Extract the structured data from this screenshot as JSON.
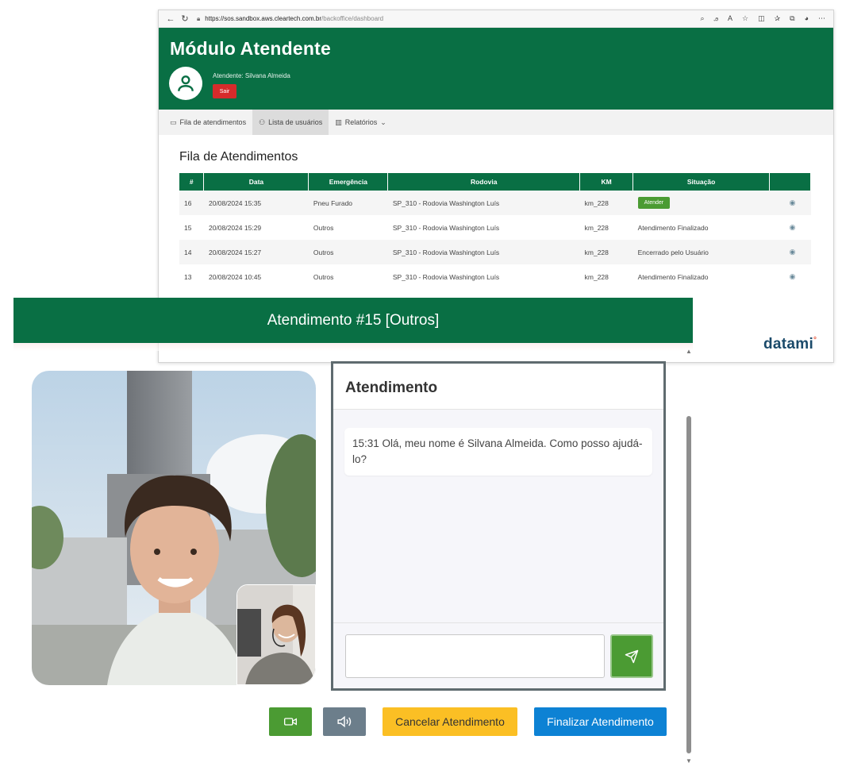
{
  "browser": {
    "url_host": "https://sos.sandbox.aws.cleartech.com.br",
    "url_path": "/backoffice/dashboard"
  },
  "app": {
    "title": "Módulo Atendente",
    "attendant_label": "Atendente: Silvana Almeida",
    "logout_label": "Sair",
    "tabs": [
      {
        "label": "Fila de atendimentos",
        "icon": "queue-icon"
      },
      {
        "label": "Lista de usuários",
        "icon": "users-icon"
      },
      {
        "label": "Relatórios",
        "icon": "chart-icon"
      }
    ],
    "queue_title": "Fila de Atendimentos",
    "table": {
      "headers": [
        "#",
        "Data",
        "Emergência",
        "Rodovia",
        "KM",
        "Situação",
        ""
      ],
      "rows": [
        {
          "id": "16",
          "date": "20/08/2024 15:35",
          "emergency": "Pneu Furado",
          "road": "SP_310 - Rodovia Washington Luís",
          "km": "km_228",
          "status": "Atender"
        },
        {
          "id": "15",
          "date": "20/08/2024 15:29",
          "emergency": "Outros",
          "road": "SP_310 - Rodovia Washington Luís",
          "km": "km_228",
          "status": "Atendimento Finalizado"
        },
        {
          "id": "14",
          "date": "20/08/2024 15:27",
          "emergency": "Outros",
          "road": "SP_310 - Rodovia Washington Luís",
          "km": "km_228",
          "status": "Encerrado pelo Usuário"
        },
        {
          "id": "13",
          "date": "20/08/2024 10:45",
          "emergency": "Outros",
          "road": "SP_310 - Rodovia Washington Luís",
          "km": "km_228",
          "status": "Atendimento Finalizado"
        }
      ]
    },
    "brand": "datami"
  },
  "modal": {
    "title": "Atendimento #15 [Outros]",
    "chat_title": "Atendimento",
    "messages": [
      {
        "text": "15:31 Olá, meu nome é Silvana Almeida. Como posso ajudá-lo?"
      }
    ],
    "input_value": "",
    "buttons": {
      "cancel": "Cancelar Atendimento",
      "finish": "Finalizar Atendimento"
    }
  },
  "colors": {
    "brand_green": "#096f44",
    "success_green": "#4b9b33",
    "danger_red": "#d62b2b",
    "warning_yellow": "#fbbf24",
    "primary_blue": "#0d82d4",
    "secondary_gray": "#6c7e8b"
  }
}
